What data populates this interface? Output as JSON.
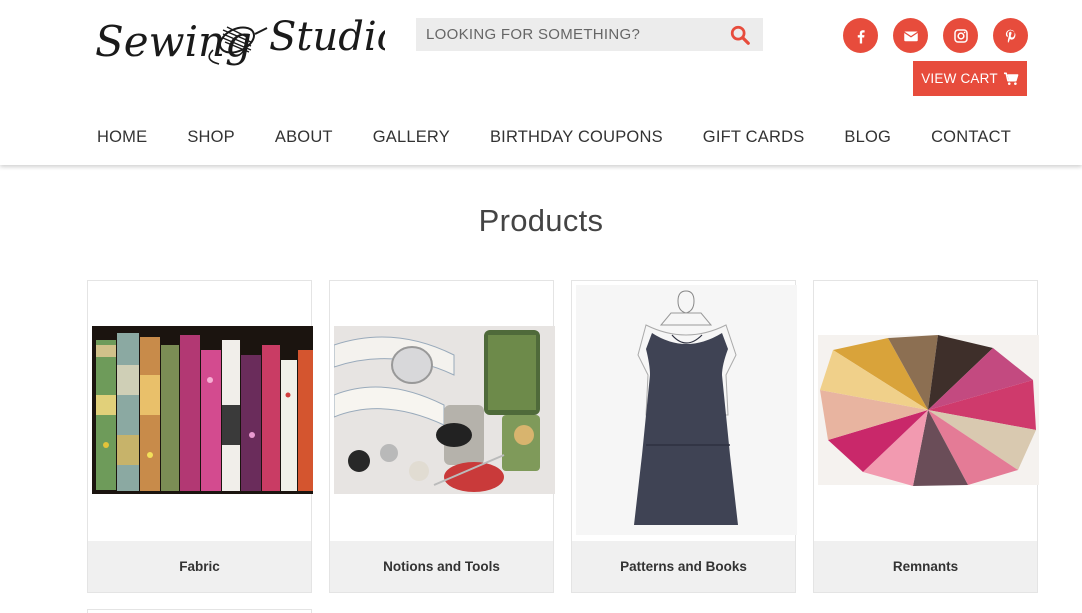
{
  "header": {
    "logo": {
      "text_left": "Sewing",
      "text_right": "Studio",
      "alt": "Sewing Studio"
    },
    "search": {
      "placeholder": "LOOKING FOR SOMETHING?",
      "value": "",
      "icon": "search-icon"
    },
    "social": [
      {
        "name": "facebook",
        "icon": "facebook-icon"
      },
      {
        "name": "email",
        "icon": "envelope-icon"
      },
      {
        "name": "instagram",
        "icon": "instagram-icon"
      },
      {
        "name": "pinterest",
        "icon": "pinterest-icon"
      }
    ],
    "cart": {
      "label": "VIEW CART",
      "icon": "cart-icon"
    },
    "nav": [
      {
        "label": "HOME"
      },
      {
        "label": "SHOP"
      },
      {
        "label": "ABOUT"
      },
      {
        "label": "GALLERY"
      },
      {
        "label": "BIRTHDAY COUPONS"
      },
      {
        "label": "GIFT CARDS"
      },
      {
        "label": "BLOG"
      },
      {
        "label": "CONTACT"
      }
    ]
  },
  "main": {
    "title": "Products",
    "categories": [
      {
        "label": "Fabric",
        "image": "fabric-bolts"
      },
      {
        "label": "Notions and Tools",
        "image": "notions-tools"
      },
      {
        "label": "Patterns and Books",
        "image": "pattern-dress"
      },
      {
        "label": "Remnants",
        "image": "fabric-remnants"
      }
    ]
  },
  "colors": {
    "accent": "#e74c3c",
    "caption_bg": "#f0f0f0",
    "text": "#333333"
  }
}
